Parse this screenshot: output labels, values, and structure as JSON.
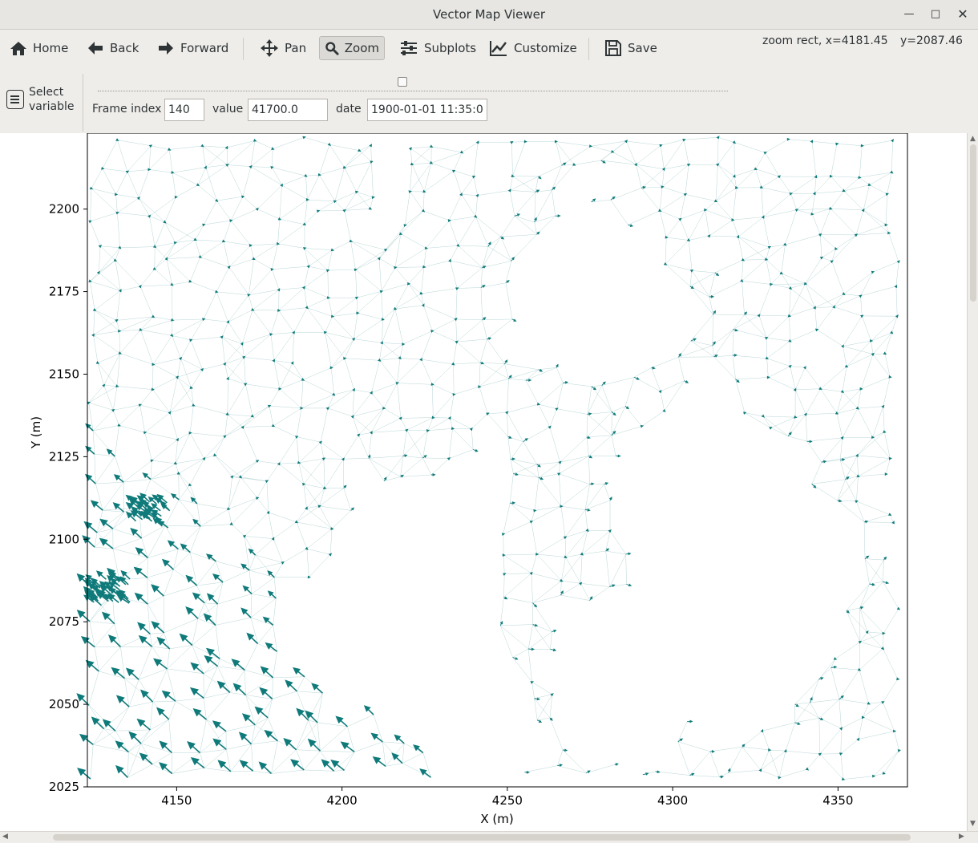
{
  "window": {
    "title": "Vector Map Viewer"
  },
  "toolbar": {
    "home": "Home",
    "back": "Back",
    "forward": "Forward",
    "pan": "Pan",
    "zoom": "Zoom",
    "subplots": "Subplots",
    "customize": "Customize",
    "save": "Save"
  },
  "status": {
    "x_readout": "zoom rect, x=4181.45",
    "y_readout": "y=2087.46"
  },
  "controls": {
    "select_variable_line1": "Select",
    "select_variable_line2": "variable",
    "frame_index_label": "Frame index",
    "frame_index_value": "140",
    "value_label": "value",
    "value_value": "41700.0",
    "date_label": "date",
    "date_value": "1900-01-01 11:35:00"
  },
  "colors": {
    "vector": "#0f7a7a",
    "mesh": "#7fb3b3"
  },
  "chart_data": {
    "type": "quiver",
    "xlabel": "X (m)",
    "ylabel": "Y (m)",
    "xlim": [
      4123,
      4371
    ],
    "ylim": [
      2025,
      2223
    ],
    "xticks": [
      "4150",
      "4200",
      "4250",
      "4300",
      "4350"
    ],
    "yticks": [
      "2025",
      "2050",
      "2075",
      "2100",
      "2125",
      "2150",
      "2175",
      "2200"
    ],
    "grid": false
  }
}
